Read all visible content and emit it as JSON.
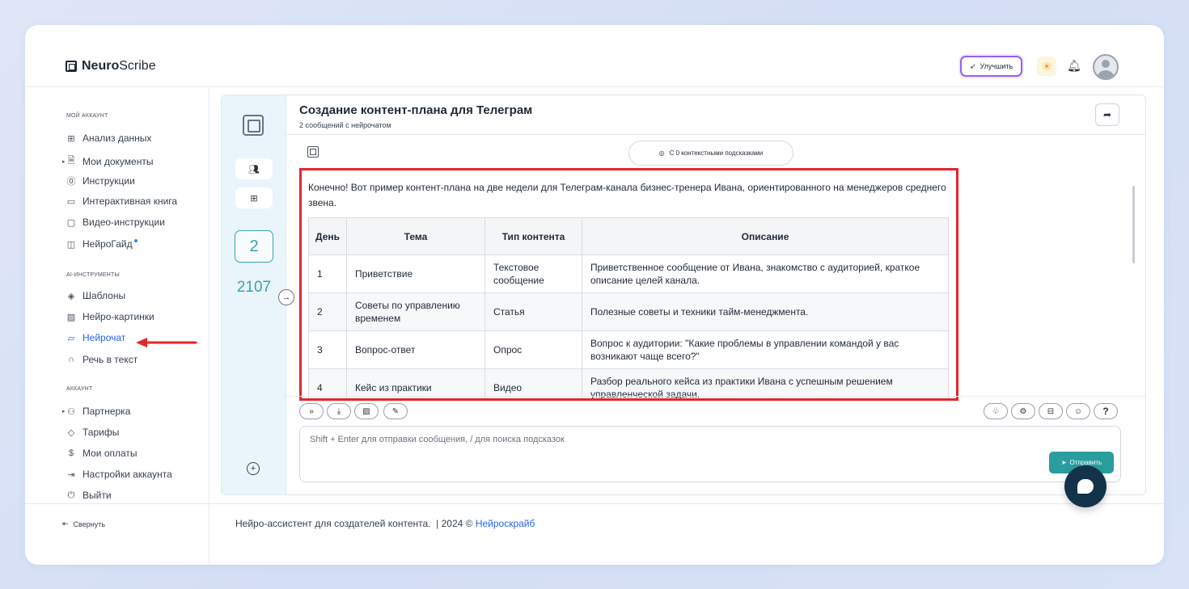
{
  "brand": {
    "name_bold": "Neuro",
    "name_light": "Scribe"
  },
  "header": {
    "upgrade_label": "Улучшить"
  },
  "sidebar": {
    "section_account": "МОЙ АККАУНТ",
    "account_items": [
      {
        "label": "Анализ данных",
        "icon": "grid-icon"
      },
      {
        "label": "Мои документы",
        "icon": "document-icon"
      },
      {
        "label": "Инструкции",
        "icon": "help-circle-icon"
      },
      {
        "label": "Интерактивная книга",
        "icon": "book-icon"
      },
      {
        "label": "Видео-инструкции",
        "icon": "video-icon"
      },
      {
        "label": "НейроГайд",
        "icon": "guide-icon"
      }
    ],
    "section_tools": "AI-ИНСТРУМЕНТЫ",
    "tool_items": [
      {
        "label": "Шаблоны",
        "icon": "layers-icon"
      },
      {
        "label": "Нейро-картинки",
        "icon": "image-icon"
      },
      {
        "label": "Нейрочат",
        "icon": "chat-icon"
      },
      {
        "label": "Речь в текст",
        "icon": "headphones-icon"
      }
    ],
    "section_acc2": "АККАУНТ",
    "acc2_items": [
      {
        "label": "Партнерка",
        "icon": "users-icon"
      },
      {
        "label": "Тарифы",
        "icon": "tag-icon"
      },
      {
        "label": "Мои оплаты",
        "icon": "dollar-icon"
      },
      {
        "label": "Настройки аккаунта",
        "icon": "login-icon"
      },
      {
        "label": "Выйти",
        "icon": "power-icon"
      }
    ],
    "collapse_label": "Свернуть"
  },
  "rail": {
    "chat_number": "2",
    "token_count": "2107"
  },
  "chat": {
    "title": "Создание контент-плана для Телеграм",
    "subtitle": "2 сообщений с нейрочатом",
    "hints_label": "С 0 контекстными подсказками",
    "answer_intro": "Конечно! Вот пример контент-плана на две недели для Телеграм-канала бизнес-тренера Ивана, ориентированного на менеджеров среднего звена.",
    "table": {
      "headers": [
        "День",
        "Тема",
        "Тип контента",
        "Описание"
      ],
      "rows": [
        [
          "1",
          "Приветствие",
          "Текстовое сообщение",
          "Приветственное сообщение от Ивана, знакомство с аудиторией, краткое описание целей канала."
        ],
        [
          "2",
          "Советы по управлению временем",
          "Статья",
          "Полезные советы и техники тайм-менеджмента."
        ],
        [
          "3",
          "Вопрос-ответ",
          "Опрос",
          "Вопрос к аудитории: \"Какие проблемы в управлении командой у вас возникают чаще всего?\""
        ],
        [
          "4",
          "Кейс из практики",
          "Видео",
          "Разбор реального кейса из практики Ивана с успешным решением управленческой задачи."
        ]
      ]
    },
    "input_placeholder": "Shift + Enter для отправки сообщения, / для поиска подсказок",
    "send_label": "Отправить",
    "help_label": "?"
  },
  "footer": {
    "text": "Нейро-ассистент для создателей контента.  | 2024 © ",
    "link": "Нейроскрайб"
  },
  "colors": {
    "accent": "#2a9d9f",
    "highlight": "#e3262c",
    "link": "#2563eb"
  }
}
